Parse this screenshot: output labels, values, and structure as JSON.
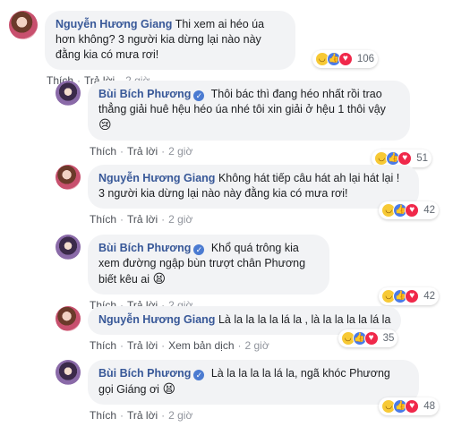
{
  "comments": [
    {
      "name": "Nguyễn Hương Giang",
      "verified": false,
      "text": "Thi xem ai héo úa hơn không? 3 người kia dừng lại nào này đằng kia có mưa rơi!",
      "reaction_count": "106",
      "actions": [
        "Thích",
        "Trả lời"
      ],
      "time": "2 giờ"
    },
    {
      "name": "Bùi Bích Phương",
      "verified": true,
      "text": "Thôi bác thì đang héo nhất rồi trao thẳng giải huê hệu héo úa nhé tôi xin giải ở hệu 1 thôi vậy",
      "emoji": "😢",
      "reaction_count": "51",
      "actions": [
        "Thích",
        "Trả lời"
      ],
      "time": "2 giờ"
    },
    {
      "name": "Nguyễn Hương Giang",
      "verified": false,
      "text": "Không hát tiếp câu hát ah lại hát lại ! 3 người kia dừng lại nào này đằng kia có mưa rơi!",
      "reaction_count": "42",
      "actions": [
        "Thích",
        "Trả lời"
      ],
      "time": "2 giờ"
    },
    {
      "name": "Bùi Bích Phương",
      "verified": true,
      "text": "Khổ quá trông kia xem đường ngập bùn trượt chân Phương biết kêu ai",
      "emoji": "😫",
      "reaction_count": "42",
      "actions": [
        "Thích",
        "Trả lời"
      ],
      "time": "2 giờ"
    },
    {
      "name": "Nguyễn Hương Giang",
      "verified": false,
      "text": "Là la la la la lá la , là la la la la lá la",
      "reaction_count": "35",
      "actions": [
        "Thích",
        "Trả lời",
        "Xem bản dịch"
      ],
      "time": "2 giờ"
    },
    {
      "name": "Bùi Bích Phương",
      "verified": true,
      "text": "Là la la la la lá la, ngã khóc Phương gọi Giáng ơi",
      "emoji": "😫",
      "reaction_count": "48",
      "actions": [
        "Thích",
        "Trả lời"
      ],
      "time": "2 giờ"
    }
  ],
  "colors": {
    "name": "#385898",
    "bubble": "#f2f3f5",
    "meta": "#90949c"
  }
}
